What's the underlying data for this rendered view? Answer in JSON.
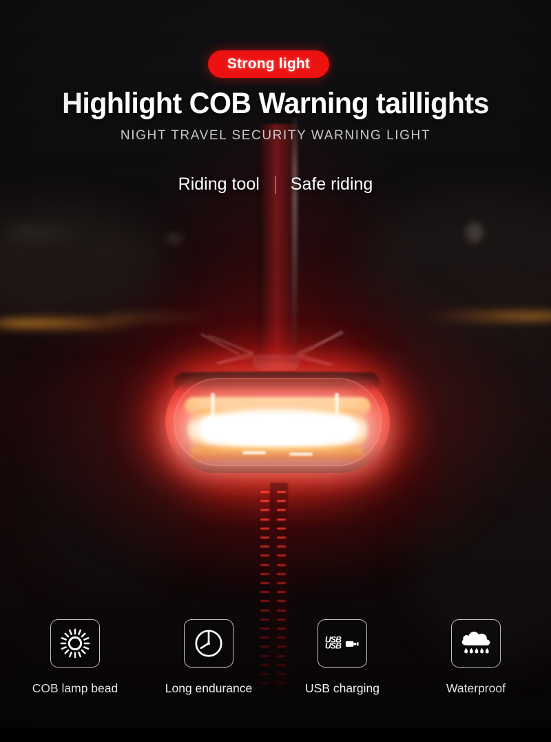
{
  "poster": {
    "badge": {
      "label": "Strong light",
      "color": "#ee1111"
    },
    "headline": "Highlight COB Warning taillights",
    "subhead": "NIGHT TRAVEL SECURITY WARNING LIGHT",
    "tagline": {
      "left": "Riding tool",
      "separator": "|",
      "right": "Safe riding"
    }
  },
  "features": [
    {
      "icon": "sun-icon",
      "label": "COB lamp bead"
    },
    {
      "icon": "clock-icon",
      "label": "Long endurance"
    },
    {
      "icon": "usb-icon",
      "label": "USB charging",
      "text": "USB"
    },
    {
      "icon": "rain-cloud-icon",
      "label": "Waterproof"
    }
  ],
  "colors": {
    "background": "#101010",
    "accent_red": "#ee1111",
    "light_glow_red": "#ff2828",
    "headline_text": "#fdfdfd",
    "subhead_text": "#c9c9c9",
    "label_text": "#f2f2f2",
    "amber_streak": "#ffa830"
  }
}
